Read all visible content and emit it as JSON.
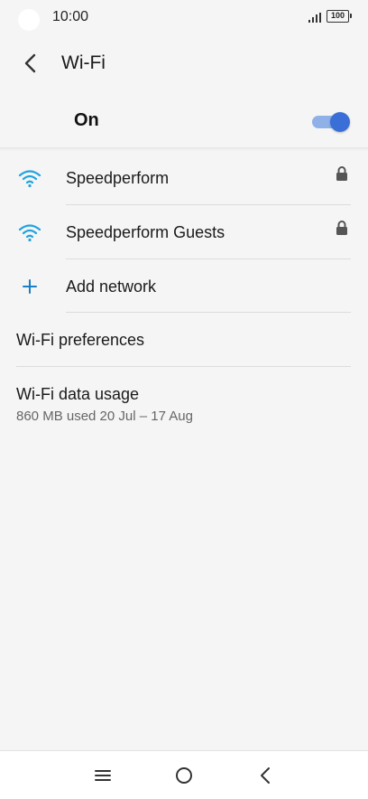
{
  "status": {
    "time": "10:00",
    "battery": "100"
  },
  "header": {
    "title": "Wi-Fi",
    "back_icon": "chevron-left-icon"
  },
  "master": {
    "label": "On",
    "enabled": true,
    "accent_color": "#3a6fd8"
  },
  "networks": [
    {
      "name": "Speedperform",
      "icon": "wifi-icon",
      "secured": true
    },
    {
      "name": "Speedperform Guests",
      "icon": "wifi-icon",
      "secured": true
    }
  ],
  "add_network": {
    "label": "Add network",
    "icon": "plus-icon"
  },
  "preferences": {
    "label": "Wi-Fi preferences"
  },
  "data_usage": {
    "label": "Wi-Fi data usage",
    "detail": "860 MB used 20 Jul – 17 Aug"
  },
  "navbar": {
    "icons": [
      "menu-icon",
      "home-icon",
      "back-icon"
    ]
  }
}
